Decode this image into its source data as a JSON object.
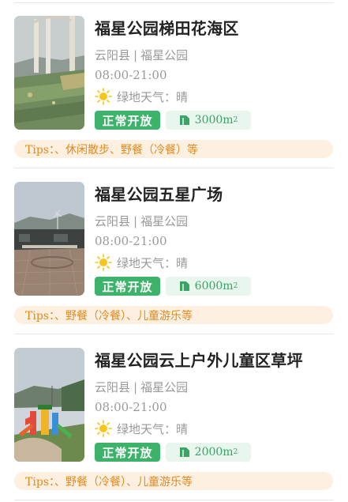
{
  "cards": [
    {
      "title": "福星公园梯田花海区",
      "county": "云阳县",
      "park": "福星公园",
      "separator": "|",
      "hours": "08:00-21:00",
      "weather": "绿地天气：晴",
      "status": "正常开放",
      "area_value": "3000m",
      "area_unit_sup": "2",
      "tips": "Tips：、休闲散步、野餐（冷餐）等"
    },
    {
      "title": "福星公园五星广场",
      "county": "云阳县",
      "park": "福星公园",
      "separator": "|",
      "hours": "08:00-21:00",
      "weather": "绿地天气：晴",
      "status": "正常开放",
      "area_value": "6000m",
      "area_unit_sup": "2",
      "tips": "Tips：、野餐（冷餐）、儿童游乐等"
    },
    {
      "title": "福星公园云上户外儿童区草坪",
      "county": "云阳县",
      "park": "福星公园",
      "separator": "|",
      "hours": "08:00-21:00",
      "weather": "绿地天气：晴",
      "status": "正常开放",
      "area_value": "2000m",
      "area_unit_sup": "2",
      "tips": "Tips：、野餐（冷餐）、儿童游乐等"
    }
  ],
  "colors": {
    "status_green": "#3db26a",
    "area_bg": "#e8f6ee",
    "tips_bg": "#fdf0e0",
    "tips_text": "#e08a1e"
  },
  "icons": [
    "sun-icon",
    "area-icon"
  ]
}
